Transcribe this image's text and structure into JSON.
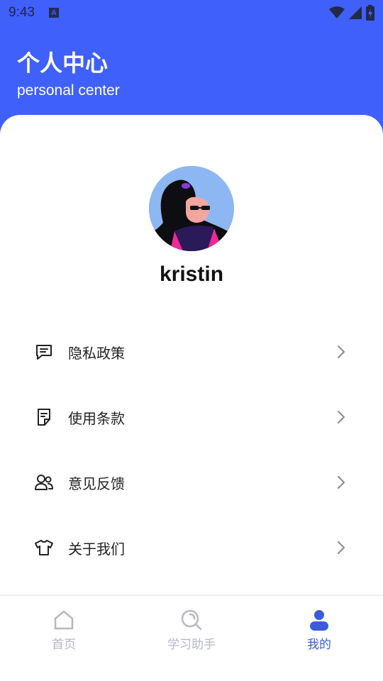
{
  "status_bar": {
    "time": "9:43",
    "notification_icon": "A"
  },
  "header": {
    "title": "个人中心",
    "subtitle": "personal center"
  },
  "profile": {
    "username": "kristin"
  },
  "menu": [
    {
      "label": "隐私政策",
      "icon": "message-square-icon"
    },
    {
      "label": "使用条款",
      "icon": "document-icon"
    },
    {
      "label": "意见反馈",
      "icon": "users-icon"
    },
    {
      "label": "关于我们",
      "icon": "tshirt-icon"
    }
  ],
  "tabs": [
    {
      "label": "首页",
      "icon": "home-icon",
      "active": false
    },
    {
      "label": "学习助手",
      "icon": "search-icon",
      "active": false
    },
    {
      "label": "我的",
      "icon": "user-icon",
      "active": true
    }
  ],
  "colors": {
    "primary": "#4060fb",
    "tab_active": "#3b5bdb",
    "tab_inactive": "#b6b6c6"
  }
}
